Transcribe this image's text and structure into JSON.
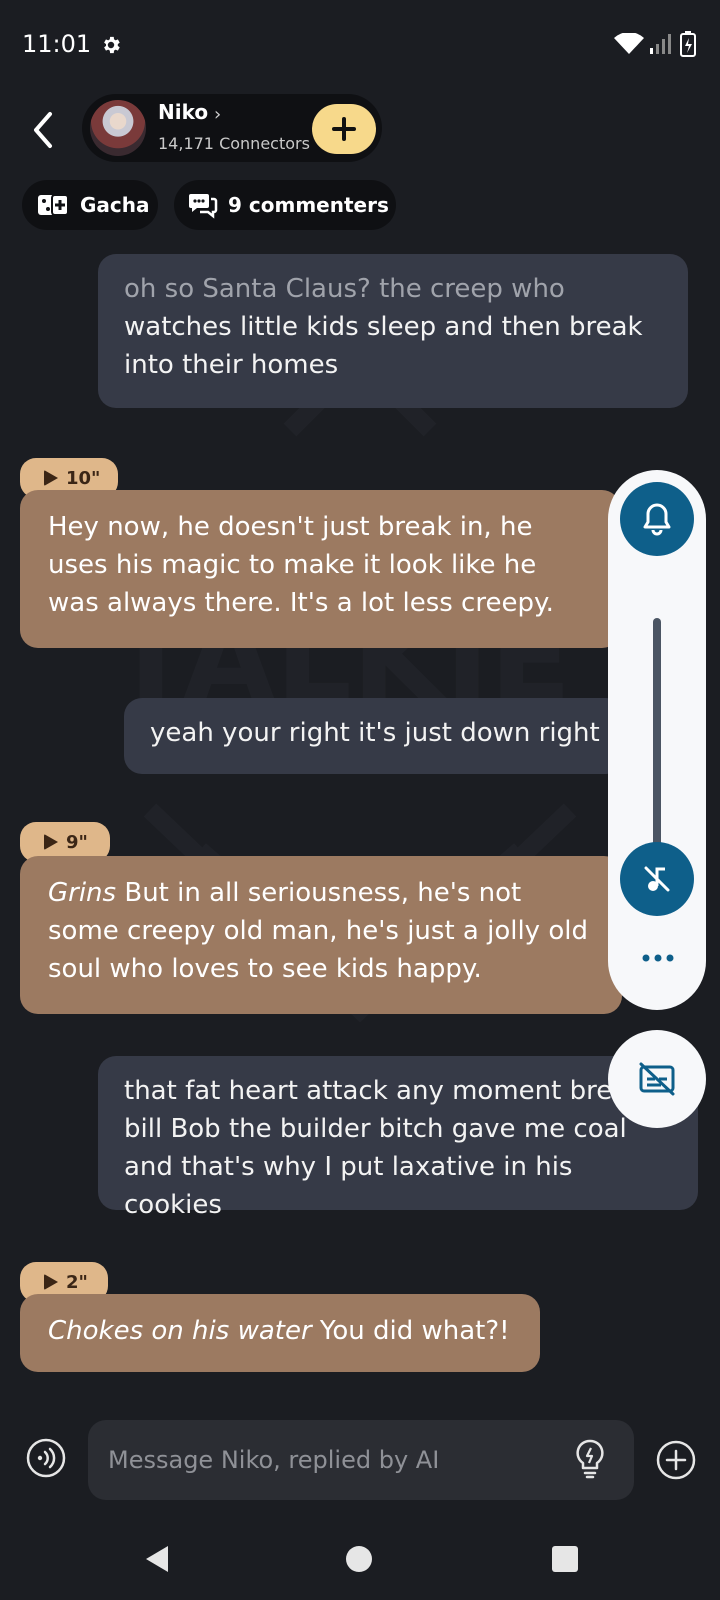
{
  "status_bar": {
    "time": "11:01"
  },
  "header": {
    "character_name": "Niko",
    "name_chevron": "›",
    "connectors": "14,171 Connectors",
    "add_icon": "plus-icon"
  },
  "chips": {
    "gacha": "Gacha",
    "commenters": "9 commenters"
  },
  "messages": {
    "m1": {
      "faded_line": "oh so Santa Claus? the creep who",
      "text": "watches little kids sleep and then break into their homes"
    },
    "m2": {
      "duration": "10\"",
      "text": "Hey now, he doesn't just break in, he uses his magic to make it look like he was always there. It's a lot less creepy."
    },
    "m3": {
      "text": "yeah your right it's just down right s"
    },
    "m4": {
      "duration": "9\"",
      "italic": "Grins",
      "text": " But in all seriousness, he's not some creepy old man, he's just a jolly old soul who loves to see kids happy."
    },
    "m5": {
      "text": "that fat heart attack any moment brea bill Bob the builder bitch gave me coal and that's why I put laxative in his cookies"
    },
    "m6": {
      "duration": "2\"",
      "italic": "Chokes on his water",
      "text": " You did what?!"
    }
  },
  "side_panel": {
    "icons": [
      "bell-icon",
      "music-off-icon",
      "more-icon",
      "subtitles-off-icon"
    ]
  },
  "composer": {
    "placeholder": "Message Niko, replied by AI"
  },
  "colors": {
    "background": "#1b1d22",
    "user_bubble": "#363a47",
    "ai_bubble": "#9c7a61",
    "duration_badge": "#dfb78a",
    "accent_yellow": "#f7d98b",
    "accent_blue": "#0e5f8a"
  }
}
